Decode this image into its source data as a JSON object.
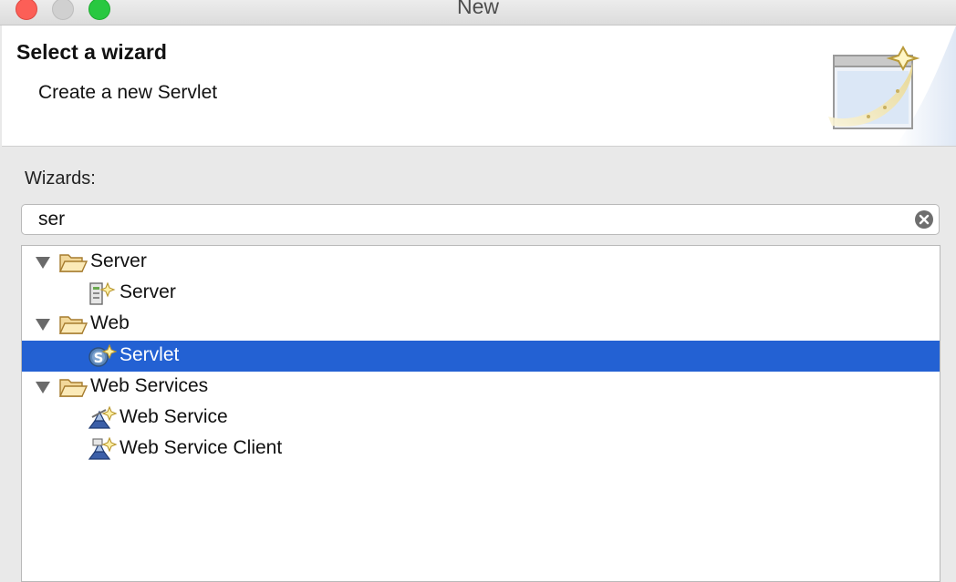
{
  "window": {
    "title": "New"
  },
  "header": {
    "title": "Select a wizard",
    "description": "Create a new Servlet"
  },
  "wizards_label": "Wizards:",
  "filter": {
    "value": "ser"
  },
  "tree": {
    "rows": [
      {
        "label": "Server",
        "type": "category",
        "expanded": true,
        "icon": "folder-open-icon"
      },
      {
        "label": "Server",
        "type": "wizard",
        "icon": "new-server-icon"
      },
      {
        "label": "Web",
        "type": "category",
        "expanded": true,
        "icon": "folder-open-icon"
      },
      {
        "label": "Servlet",
        "type": "wizard",
        "icon": "new-servlet-icon",
        "selected": true
      },
      {
        "label": "Web Services",
        "type": "category",
        "expanded": true,
        "icon": "folder-open-icon"
      },
      {
        "label": "Web Service",
        "type": "wizard",
        "icon": "new-web-service-icon"
      },
      {
        "label": "Web Service Client",
        "type": "wizard",
        "icon": "new-web-service-client-icon"
      }
    ]
  },
  "colors": {
    "selection": "#2361d3",
    "close": "#fc5f57",
    "maximize": "#28c840"
  }
}
